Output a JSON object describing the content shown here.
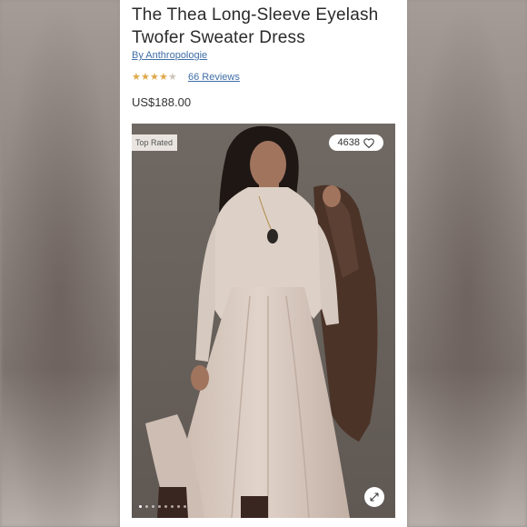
{
  "product": {
    "title": "The Thea Long-Sleeve Eyelash Twofer Sweater Dress",
    "brand": "By Anthropologie",
    "rating": 4.5,
    "reviews": "66 Reviews",
    "price": "US$188.00"
  },
  "gallery": {
    "badge": "Top Rated",
    "likes": "4638",
    "slide_count": 8,
    "active_slide": 1
  },
  "colors": {
    "link": "#3f6ea6",
    "star": "#e0a84a",
    "dress": "#d8c9bf"
  }
}
